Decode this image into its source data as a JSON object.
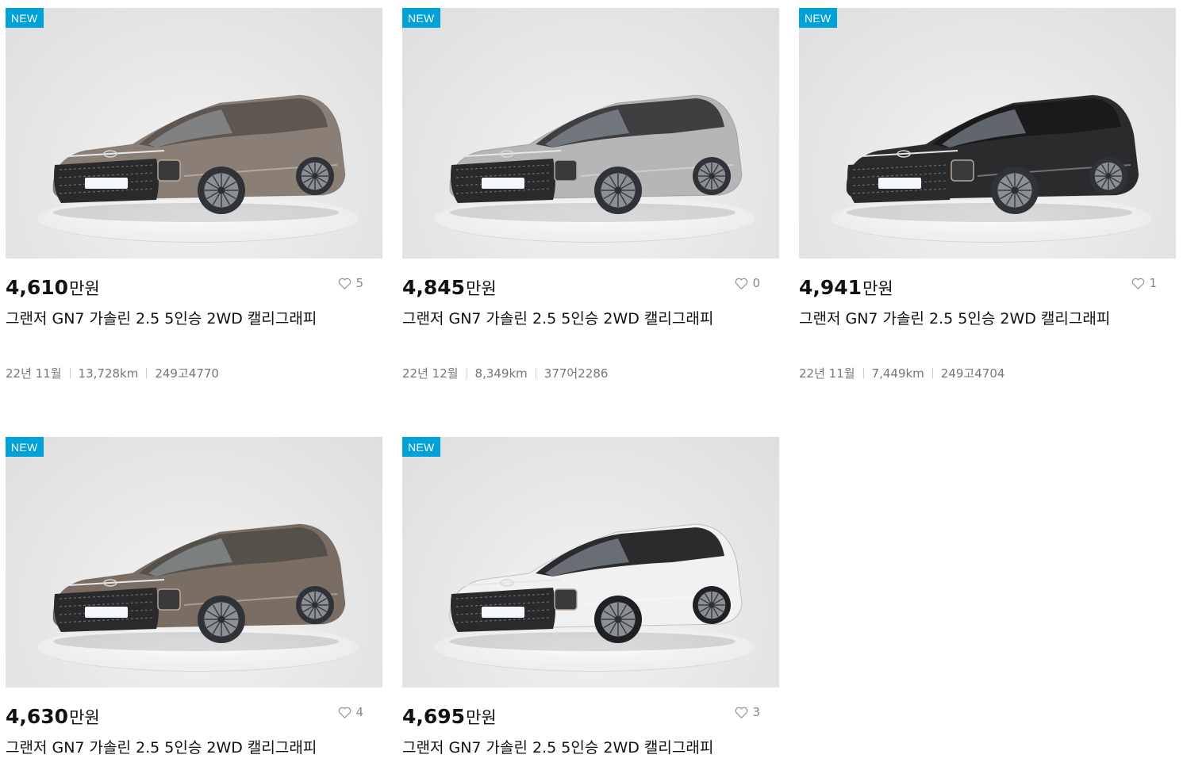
{
  "listings": [
    {
      "badge": "NEW",
      "price": "4,610",
      "unit": "만원",
      "likes": "5",
      "title": "그랜저 GN7 가솔린 2.5 5인승 2WD 캘리그래피",
      "date": "22년 11월",
      "mileage": "13,728km",
      "plate": "249고4770",
      "body_color": "#8a7f76",
      "roof_color": "#5e5650",
      "wheel": "#2f3236"
    },
    {
      "badge": "NEW",
      "price": "4,845",
      "unit": "만원",
      "likes": "0",
      "title": "그랜저 GN7 가솔린 2.5 5인승 2WD 캘리그래피",
      "date": "22년 12월",
      "mileage": "8,349km",
      "plate": "377어2286",
      "body_color": "#b6b6b6",
      "roof_color": "#3f3f42",
      "wheel": "#2f3236"
    },
    {
      "badge": "NEW",
      "price": "4,941",
      "unit": "만원",
      "likes": "1",
      "title": "그랜저 GN7 가솔린 2.5 5인승 2WD 캘리그래피",
      "date": "22년 11월",
      "mileage": "7,449km",
      "plate": "249고4704",
      "body_color": "#2b2b2e",
      "roof_color": "#1a1a1c",
      "wheel": "#2f3236"
    },
    {
      "badge": "NEW",
      "price": "4,630",
      "unit": "만원",
      "likes": "4",
      "title": "그랜저 GN7 가솔린 2.5 5인승 2WD 캘리그래피",
      "body_color": "#7a6e64",
      "roof_color": "#55504a",
      "wheel": "#2f3236"
    },
    {
      "badge": "NEW",
      "price": "4,695",
      "unit": "만원",
      "likes": "3",
      "title": "그랜저 GN7 가솔린 2.5 5인승 2WD 캘리그래피",
      "body_color": "#f1f1f1",
      "roof_color": "#2b2b2e",
      "wheel": "#1f2023"
    }
  ]
}
